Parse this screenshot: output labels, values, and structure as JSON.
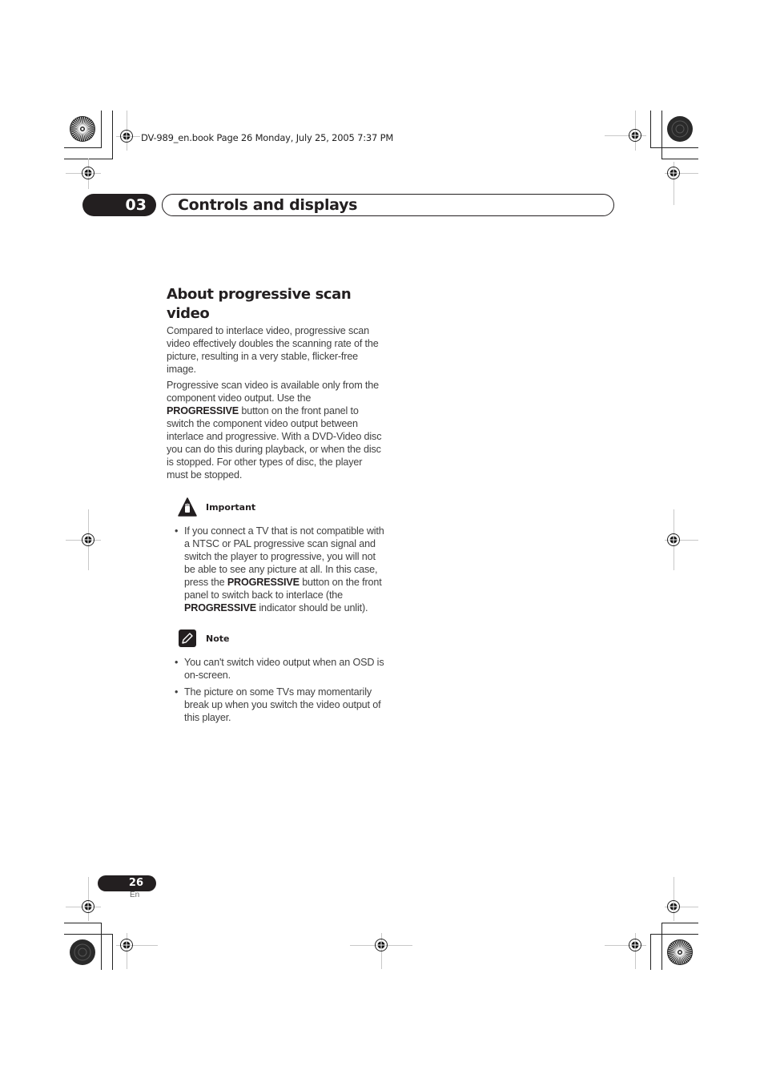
{
  "print_header": {
    "file_info": "DV-989_en.book  Page 26  Monday, July 25, 2005  7:37 PM"
  },
  "chapter": {
    "number": "03",
    "title": "Controls and displays"
  },
  "section": {
    "title": "About progressive scan video",
    "paragraphs": [
      {
        "text": "Compared to interlace video, progressive scan video effectively doubles the scanning rate of the picture, resulting in a very stable, flicker-free image."
      },
      {
        "before": "Progressive scan video is available only from the component video output. Use the ",
        "bold": "PROGRESSIVE",
        "after": " button on the front panel to switch the component video output between interlace and progressive. With a DVD-Video disc you can do this during playback, or when the disc is stopped. For other types of disc, the player must be stopped."
      }
    ]
  },
  "important": {
    "label": "Important",
    "icon": "important-hand-icon",
    "items": [
      {
        "part1": "If you connect a TV that is not compatible with a NTSC or PAL progressive scan signal and switch the player to progressive, you will not be able to see any picture at all. In this case, press the ",
        "bold1": "PROGRESSIVE",
        "part2": " button on the front panel to switch back to interlace (the ",
        "bold2": "PROGRESSIVE",
        "part3": " indicator should be unlit)."
      }
    ]
  },
  "note": {
    "label": "Note",
    "icon": "note-pencil-icon",
    "items": [
      "You can't switch video output when an OSD is on-screen.",
      "The picture on some TVs may momentarily break up when you switch the video output of this player."
    ]
  },
  "footer": {
    "page_number": "26",
    "language": "En"
  }
}
